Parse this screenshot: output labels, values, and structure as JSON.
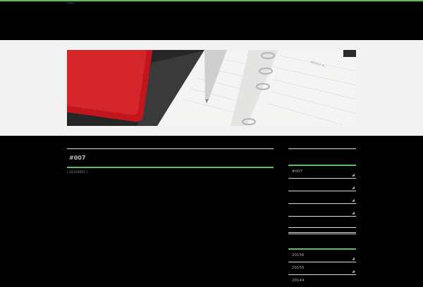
{
  "header": {
    "top_text": "••••"
  },
  "hero": {
    "planner_text": "WEEKLY PL"
  },
  "main": {
    "post_title": "#007",
    "post_meta": "( 20150601 )  .  ,"
  },
  "sidebar": {
    "recent_items": [
      {
        "label": "#007"
      },
      {
        "label": ""
      },
      {
        "label": ""
      },
      {
        "label": ""
      }
    ],
    "archive_items": [
      {
        "label": "20156"
      },
      {
        "label": "20155"
      },
      {
        "label": "20144"
      }
    ],
    "item_mark": "◢"
  },
  "colors": {
    "accent": "#5cc05c",
    "page_bg": "#000000",
    "banner_bg": "#f2f2f2",
    "rule": "#d8d8d8"
  }
}
